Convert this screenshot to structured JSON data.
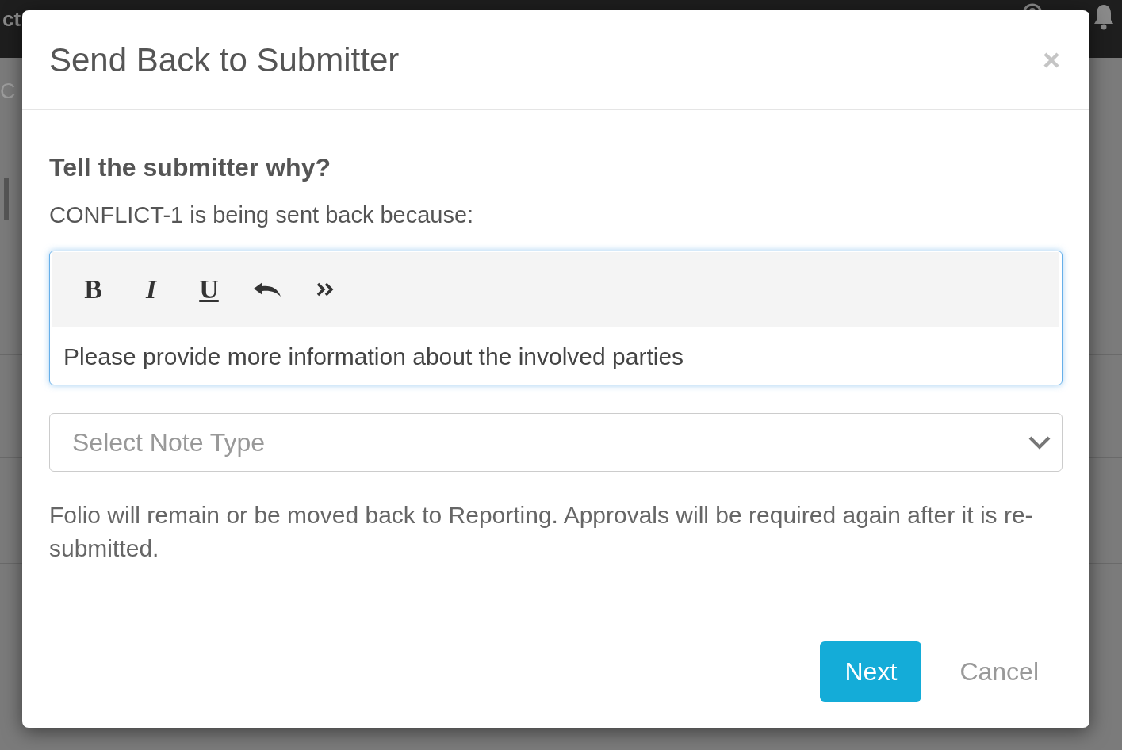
{
  "background": {
    "top_bar_text": "ct",
    "page_text": "C"
  },
  "modal": {
    "title": "Send Back to Submitter",
    "heading": "Tell the submitter why?",
    "prompt": "CONFLICT-1 is being sent back because:",
    "editor": {
      "focused": true,
      "toolbar": [
        {
          "kind": "bold",
          "label": "B"
        },
        {
          "kind": "italic",
          "label": "I"
        },
        {
          "kind": "underline",
          "label": "U"
        },
        {
          "kind": "undo"
        },
        {
          "kind": "more"
        }
      ],
      "value": "Please provide more information about the involved parties"
    },
    "note_type": {
      "placeholder": "Select Note Type"
    },
    "notice": "Folio will remain or be moved back to Reporting. Approvals will be required again after it is re-submitted.",
    "buttons": [
      {
        "kind": "primary",
        "label": "Next"
      },
      {
        "kind": "link",
        "label": "Cancel"
      }
    ]
  }
}
